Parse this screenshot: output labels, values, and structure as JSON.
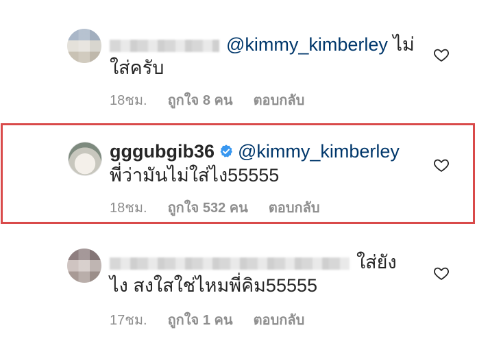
{
  "comments": [
    {
      "username": "",
      "mention": "@kimmy_kimberley",
      "text_line1": "ไม่",
      "text_line2": "ใส่ครับ",
      "time": "18ชม.",
      "likes": "ถูกใจ 8 คน",
      "reply": "ตอบกลับ"
    },
    {
      "username": "gggubgib36",
      "mention": "@kimmy_kimberley",
      "text_line2": "พี่ว่ามันไม่ใส่ไง55555",
      "time": "18ชม.",
      "likes": "ถูกใจ 532 คน",
      "reply": "ตอบกลับ"
    },
    {
      "username": "",
      "mention": "",
      "text_line1": "ใส่ยัง",
      "text_line2": "ไง สงใสใช่ไหมพี่คิม55555",
      "time": "17ชม.",
      "likes": "ถูกใจ 1 คน",
      "reply": "ตอบกลับ"
    }
  ],
  "icons": {
    "like": "heart-outline-icon",
    "verified": "verified-badge-icon"
  },
  "colors": {
    "highlight_border": "#d94a4a",
    "mention": "#00376b",
    "meta": "#8e8e8e",
    "verified": "#3897f0"
  }
}
